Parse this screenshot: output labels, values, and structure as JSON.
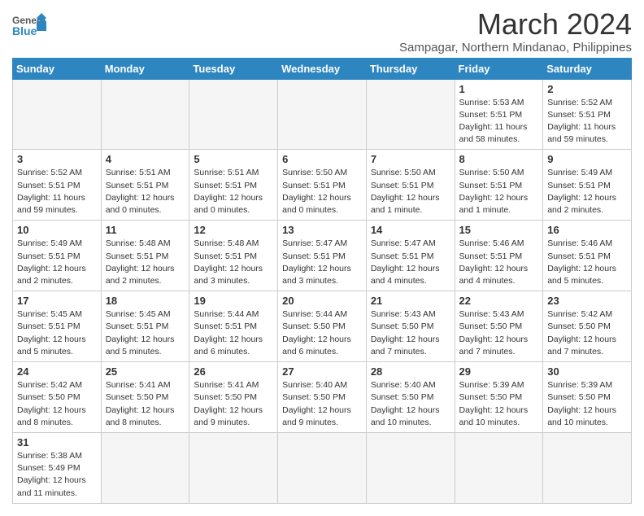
{
  "header": {
    "logo_general": "General",
    "logo_blue": "Blue",
    "month_title": "March 2024",
    "location": "Sampagar, Northern Mindanao, Philippines"
  },
  "days_of_week": [
    "Sunday",
    "Monday",
    "Tuesday",
    "Wednesday",
    "Thursday",
    "Friday",
    "Saturday"
  ],
  "weeks": [
    [
      {
        "day": "",
        "empty": true
      },
      {
        "day": "",
        "empty": true
      },
      {
        "day": "",
        "empty": true
      },
      {
        "day": "",
        "empty": true
      },
      {
        "day": "",
        "empty": true
      },
      {
        "day": "1",
        "sunrise": "5:53 AM",
        "sunset": "5:51 PM",
        "daylight": "11 hours and 58 minutes."
      },
      {
        "day": "2",
        "sunrise": "5:52 AM",
        "sunset": "5:51 PM",
        "daylight": "11 hours and 59 minutes."
      }
    ],
    [
      {
        "day": "3",
        "sunrise": "5:52 AM",
        "sunset": "5:51 PM",
        "daylight": "11 hours and 59 minutes."
      },
      {
        "day": "4",
        "sunrise": "5:51 AM",
        "sunset": "5:51 PM",
        "daylight": "12 hours and 0 minutes."
      },
      {
        "day": "5",
        "sunrise": "5:51 AM",
        "sunset": "5:51 PM",
        "daylight": "12 hours and 0 minutes."
      },
      {
        "day": "6",
        "sunrise": "5:50 AM",
        "sunset": "5:51 PM",
        "daylight": "12 hours and 0 minutes."
      },
      {
        "day": "7",
        "sunrise": "5:50 AM",
        "sunset": "5:51 PM",
        "daylight": "12 hours and 1 minute."
      },
      {
        "day": "8",
        "sunrise": "5:50 AM",
        "sunset": "5:51 PM",
        "daylight": "12 hours and 1 minute."
      },
      {
        "day": "9",
        "sunrise": "5:49 AM",
        "sunset": "5:51 PM",
        "daylight": "12 hours and 2 minutes."
      }
    ],
    [
      {
        "day": "10",
        "sunrise": "5:49 AM",
        "sunset": "5:51 PM",
        "daylight": "12 hours and 2 minutes."
      },
      {
        "day": "11",
        "sunrise": "5:48 AM",
        "sunset": "5:51 PM",
        "daylight": "12 hours and 2 minutes."
      },
      {
        "day": "12",
        "sunrise": "5:48 AM",
        "sunset": "5:51 PM",
        "daylight": "12 hours and 3 minutes."
      },
      {
        "day": "13",
        "sunrise": "5:47 AM",
        "sunset": "5:51 PM",
        "daylight": "12 hours and 3 minutes."
      },
      {
        "day": "14",
        "sunrise": "5:47 AM",
        "sunset": "5:51 PM",
        "daylight": "12 hours and 4 minutes."
      },
      {
        "day": "15",
        "sunrise": "5:46 AM",
        "sunset": "5:51 PM",
        "daylight": "12 hours and 4 minutes."
      },
      {
        "day": "16",
        "sunrise": "5:46 AM",
        "sunset": "5:51 PM",
        "daylight": "12 hours and 5 minutes."
      }
    ],
    [
      {
        "day": "17",
        "sunrise": "5:45 AM",
        "sunset": "5:51 PM",
        "daylight": "12 hours and 5 minutes."
      },
      {
        "day": "18",
        "sunrise": "5:45 AM",
        "sunset": "5:51 PM",
        "daylight": "12 hours and 5 minutes."
      },
      {
        "day": "19",
        "sunrise": "5:44 AM",
        "sunset": "5:51 PM",
        "daylight": "12 hours and 6 minutes."
      },
      {
        "day": "20",
        "sunrise": "5:44 AM",
        "sunset": "5:50 PM",
        "daylight": "12 hours and 6 minutes."
      },
      {
        "day": "21",
        "sunrise": "5:43 AM",
        "sunset": "5:50 PM",
        "daylight": "12 hours and 7 minutes."
      },
      {
        "day": "22",
        "sunrise": "5:43 AM",
        "sunset": "5:50 PM",
        "daylight": "12 hours and 7 minutes."
      },
      {
        "day": "23",
        "sunrise": "5:42 AM",
        "sunset": "5:50 PM",
        "daylight": "12 hours and 7 minutes."
      }
    ],
    [
      {
        "day": "24",
        "sunrise": "5:42 AM",
        "sunset": "5:50 PM",
        "daylight": "12 hours and 8 minutes."
      },
      {
        "day": "25",
        "sunrise": "5:41 AM",
        "sunset": "5:50 PM",
        "daylight": "12 hours and 8 minutes."
      },
      {
        "day": "26",
        "sunrise": "5:41 AM",
        "sunset": "5:50 PM",
        "daylight": "12 hours and 9 minutes."
      },
      {
        "day": "27",
        "sunrise": "5:40 AM",
        "sunset": "5:50 PM",
        "daylight": "12 hours and 9 minutes."
      },
      {
        "day": "28",
        "sunrise": "5:40 AM",
        "sunset": "5:50 PM",
        "daylight": "12 hours and 10 minutes."
      },
      {
        "day": "29",
        "sunrise": "5:39 AM",
        "sunset": "5:50 PM",
        "daylight": "12 hours and 10 minutes."
      },
      {
        "day": "30",
        "sunrise": "5:39 AM",
        "sunset": "5:50 PM",
        "daylight": "12 hours and 10 minutes."
      }
    ],
    [
      {
        "day": "31",
        "sunrise": "5:38 AM",
        "sunset": "5:49 PM",
        "daylight": "12 hours and 11 minutes."
      },
      {
        "day": "",
        "empty": true
      },
      {
        "day": "",
        "empty": true
      },
      {
        "day": "",
        "empty": true
      },
      {
        "day": "",
        "empty": true
      },
      {
        "day": "",
        "empty": true
      },
      {
        "day": "",
        "empty": true
      }
    ]
  ]
}
